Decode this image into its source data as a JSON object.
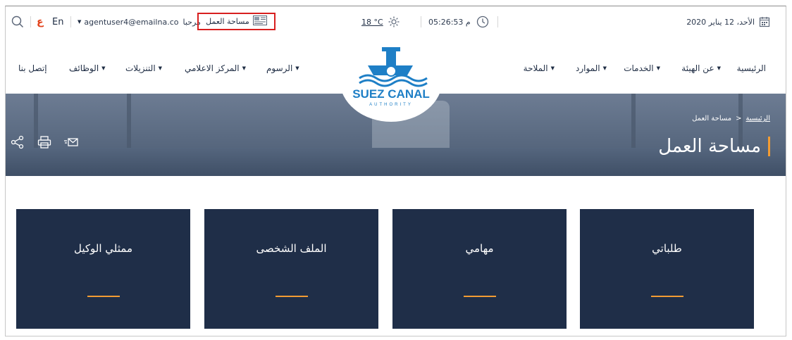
{
  "topbar": {
    "date": "الأحد، 12 يناير 2020",
    "time": "05:26:53 م",
    "temperature": "18 °C",
    "workspace_label": "مساحة العمل",
    "greeting": "مرحبا",
    "user_email": "agentuser4@emailna.co",
    "lang_en": "En",
    "lang_ar": "ع"
  },
  "nav": {
    "items_right": [
      "الرئيسية",
      "عن الهيئة",
      "الخدمات",
      "الموارد",
      "الملاحة"
    ],
    "items_left": [
      "الرسوم",
      "المركز الاعلامي",
      "التنزيلات",
      "الوظائف",
      "إتصل بنا"
    ],
    "logo_text": "SUEZ CANAL",
    "logo_subtext": "AUTHORITY"
  },
  "hero": {
    "title": "مساحة العمل",
    "breadcrumb_home": "الرئيسية",
    "breadcrumb_sep": ">",
    "breadcrumb_current": "مساحة العمل"
  },
  "cards": [
    {
      "title": "طلباتي"
    },
    {
      "title": "مهامي"
    },
    {
      "title": "الملف الشخصى"
    },
    {
      "title": "ممثلي الوكيل"
    }
  ],
  "colors": {
    "accent": "#f39c33",
    "card_bg": "#1f2e48",
    "highlight_border": "#d81f1f",
    "lang_ar": "#e2421b"
  },
  "icons": [
    "calendar-icon",
    "clock-icon",
    "sun-icon",
    "workspace-icon",
    "search-icon",
    "share-icon",
    "print-icon",
    "email-icon",
    "dropdown-caret-icon"
  ]
}
